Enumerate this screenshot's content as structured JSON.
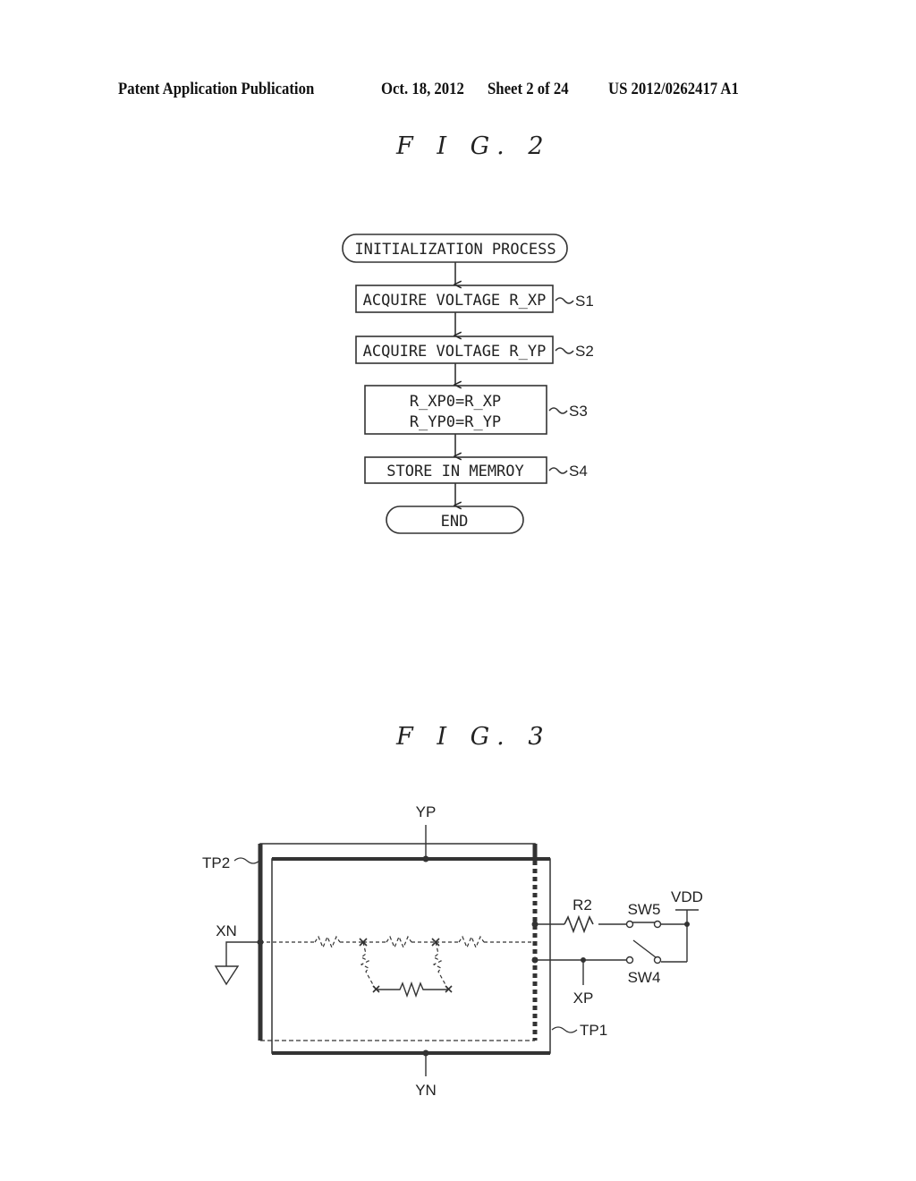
{
  "header": {
    "publication": "Patent Application Publication",
    "date": "Oct. 18, 2012",
    "sheet": "Sheet 2 of 24",
    "number": "US 2012/0262417 A1"
  },
  "fig2": {
    "title": "F I G. 2",
    "start": "INITIALIZATION PROCESS",
    "steps": [
      {
        "lines": [
          "ACQUIRE VOLTAGE R_XP"
        ],
        "ref": "S1"
      },
      {
        "lines": [
          "ACQUIRE VOLTAGE R_YP"
        ],
        "ref": "S2"
      },
      {
        "lines": [
          "R_XP0=R_XP",
          "R_YP0=R_YP"
        ],
        "ref": "S3"
      },
      {
        "lines": [
          "STORE IN MEMROY"
        ],
        "ref": "S4"
      }
    ],
    "end": "END"
  },
  "fig3": {
    "title": "F I G. 3",
    "labels": {
      "yp": "YP",
      "yn": "YN",
      "xn": "XN",
      "xp": "XP",
      "tp1": "TP1",
      "tp2": "TP2",
      "r2": "R2",
      "sw5": "SW5",
      "sw4": "SW4",
      "vdd": "VDD"
    }
  }
}
